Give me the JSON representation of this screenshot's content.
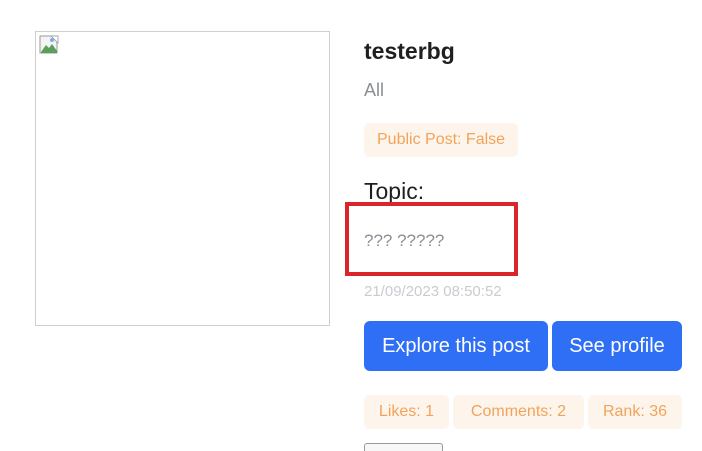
{
  "post": {
    "username": "testerbg",
    "category": "All",
    "public_badge": "Public Post: False",
    "topic_heading": "Topic:",
    "topic_value": "??? ?????",
    "timestamp": "21/09/2023 08:50:52"
  },
  "actions": {
    "explore_label": "Explore this post",
    "profile_label": "See profile"
  },
  "stats": {
    "likes": "Likes: 1",
    "comments": "Comments: 2",
    "rank": "Rank: 36"
  },
  "icons": {
    "image": "broken-image-icon"
  },
  "colors": {
    "primary_button": "#2f6ff5",
    "badge_text": "#f2a35a",
    "badge_bg": "#fdf5ec",
    "highlight": "#d8262b"
  }
}
